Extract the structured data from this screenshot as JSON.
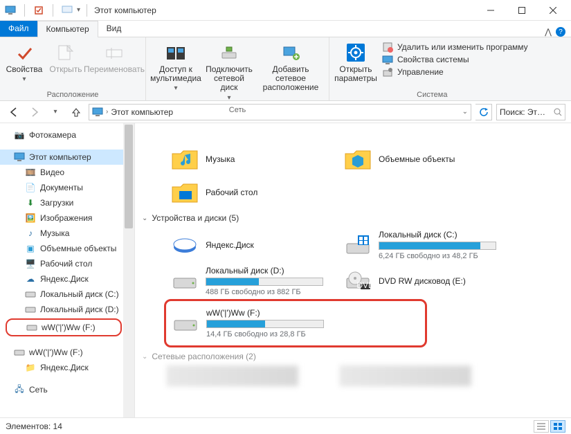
{
  "window": {
    "title": "Этот компьютер"
  },
  "tabs": {
    "file": "Файл",
    "computer": "Компьютер",
    "view": "Вид"
  },
  "ribbon": {
    "location_group": "Расположение",
    "properties": "Свойства",
    "open": "Открыть",
    "rename": "Переименовать",
    "network_group": "Сеть",
    "media_access": "Доступ к\nмультимедиа",
    "map_drive": "Подключить\nсетевой диск",
    "add_network": "Добавить сетевое\nрасположение",
    "system_group": "Система",
    "open_settings": "Открыть\nпараметры",
    "uninstall": "Удалить или изменить программу",
    "sys_props": "Свойства системы",
    "manage": "Управление"
  },
  "address": {
    "location": "Этот компьютер",
    "search_placeholder": "Поиск: Эт…"
  },
  "sidebar": {
    "camera": "Фотокамера",
    "this_pc": "Этот компьютер",
    "videos": "Видео",
    "documents": "Документы",
    "downloads": "Загрузки",
    "pictures": "Изображения",
    "music": "Музыка",
    "objects3d": "Объемные объекты",
    "desktop": "Рабочий стол",
    "yadisk": "Яндекс.Диск",
    "local_c": "Локальный диск (C:)",
    "local_d": "Локальный диск (D:)",
    "ww_f": "wW('|')Ww (F:)",
    "ww_f2": "wW('|')Ww (F:)",
    "yadisk2": "Яндекс.Диск",
    "network": "Сеть"
  },
  "content": {
    "folders": {
      "music": "Музыка",
      "objects3d": "Объемные объекты",
      "desktop": "Рабочий стол"
    },
    "devices_header": "Устройства и диски (5)",
    "network_header": "Сетевые расположения (2)",
    "drives": {
      "yadisk": {
        "name": "Яндекс.Диск"
      },
      "local_c": {
        "name": "Локальный диск (C:)",
        "sub": "6,24 ГБ свободно из 48,2 ГБ",
        "fill": 87
      },
      "local_d": {
        "name": "Локальный диск (D:)",
        "sub": "488 ГБ свободно из 882 ГБ",
        "fill": 45
      },
      "dvd": {
        "name": "DVD RW дисковод (E:)"
      },
      "ww_f": {
        "name": "wW('|')Ww (F:)",
        "sub": "14,4 ГБ свободно из 28,8 ГБ",
        "fill": 50
      }
    }
  },
  "status": {
    "text": "Элементов: 14"
  }
}
